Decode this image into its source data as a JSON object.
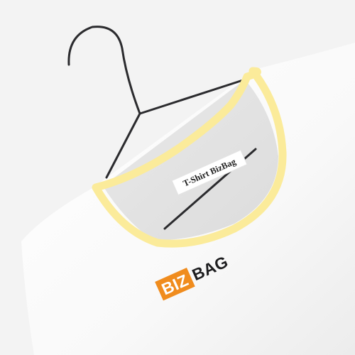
{
  "label": {
    "text": "T-Shirt BizBag"
  },
  "logo": {
    "part1": "BIZ",
    "part2": "BAG"
  },
  "colors": {
    "background": "#f3f3f3",
    "shirt": "#ffffff",
    "collar_trim": "#fbeb9a",
    "hanger": "#2b2b2e",
    "logo_accent": "#f08c1e",
    "logo_text": "#1d1d1f"
  }
}
